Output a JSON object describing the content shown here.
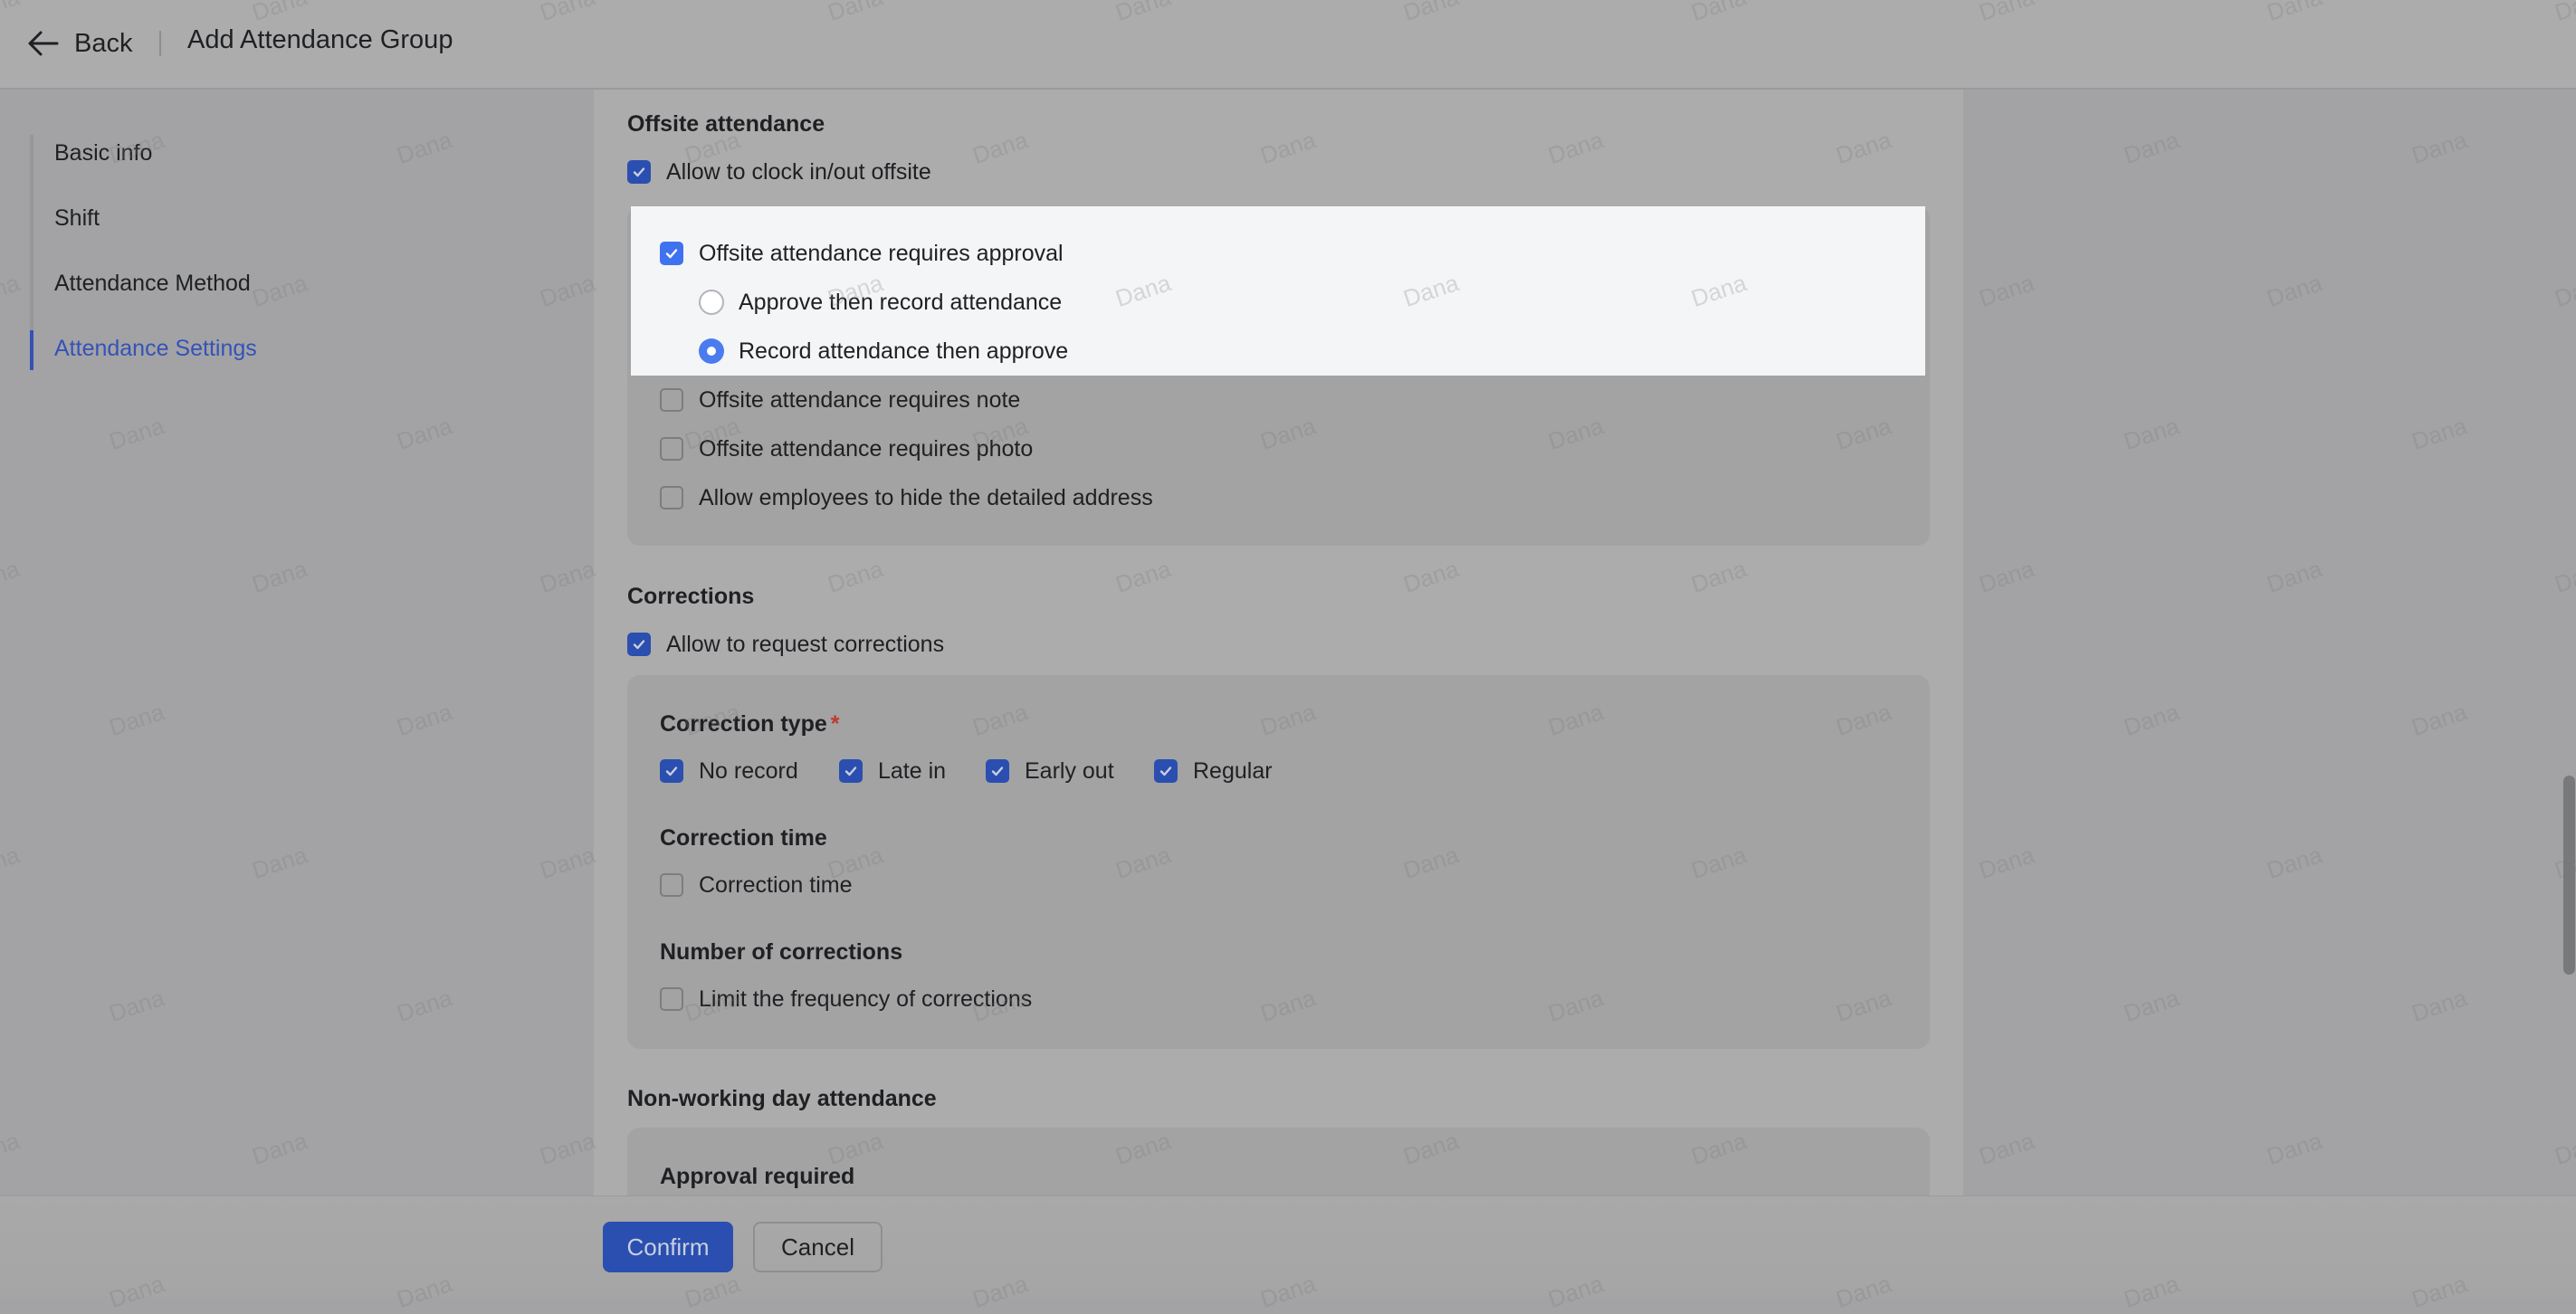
{
  "header": {
    "back_label": "Back",
    "title": "Add Attendance Group"
  },
  "sidebar": {
    "items": [
      {
        "label": "Basic info",
        "active": false
      },
      {
        "label": "Shift",
        "active": false
      },
      {
        "label": "Attendance Method",
        "active": false
      },
      {
        "label": "Attendance Settings",
        "active": true
      }
    ]
  },
  "offsite": {
    "title": "Offsite attendance",
    "allow_offsite": {
      "label": "Allow to clock in/out offsite",
      "checked": true
    },
    "requires_approval": {
      "label": "Offsite attendance requires approval",
      "checked": true
    },
    "approval_mode": {
      "options": [
        {
          "label": "Approve then record attendance",
          "selected": false
        },
        {
          "label": "Record attendance then approve",
          "selected": true
        }
      ]
    },
    "requires_note": {
      "label": "Offsite attendance requires note",
      "checked": false
    },
    "requires_photo": {
      "label": "Offsite attendance requires photo",
      "checked": false
    },
    "hide_address": {
      "label": "Allow employees to hide the detailed address",
      "checked": false
    }
  },
  "corrections": {
    "title": "Corrections",
    "allow_corrections": {
      "label": "Allow to request corrections",
      "checked": true
    },
    "type_label": "Correction type",
    "required_mark": "*",
    "types": [
      {
        "label": "No record",
        "checked": true
      },
      {
        "label": "Late in",
        "checked": true
      },
      {
        "label": "Early out",
        "checked": true
      },
      {
        "label": "Regular",
        "checked": true
      }
    ],
    "time_label": "Correction time",
    "time_option": {
      "label": "Correction time",
      "checked": false
    },
    "count_label": "Number of corrections",
    "count_option": {
      "label": "Limit the frequency of corrections",
      "checked": false
    }
  },
  "non_working": {
    "title": "Non-working day attendance",
    "approval_label": "Approval required"
  },
  "footer": {
    "confirm_label": "Confirm",
    "cancel_label": "Cancel"
  },
  "watermark": "Dana",
  "colors": {
    "accent": "#3552b8",
    "checkbox_dimmed": "#2a4fb0",
    "checkbox_highlight": "#3f72f0",
    "required": "#c0392b"
  }
}
